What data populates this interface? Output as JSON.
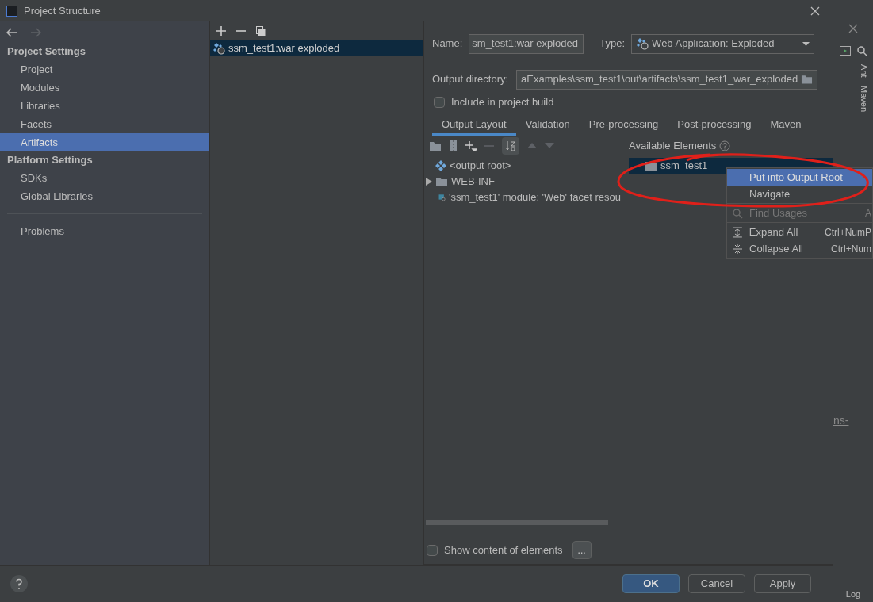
{
  "window": {
    "title": "Project Structure"
  },
  "sidebar": {
    "groups": [
      {
        "title": "Project Settings",
        "items": [
          {
            "label": "Project",
            "selected": false
          },
          {
            "label": "Modules",
            "selected": false
          },
          {
            "label": "Libraries",
            "selected": false
          },
          {
            "label": "Facets",
            "selected": false
          },
          {
            "label": "Artifacts",
            "selected": true
          }
        ]
      },
      {
        "title": "Platform Settings",
        "items": [
          {
            "label": "SDKs",
            "selected": false
          },
          {
            "label": "Global Libraries",
            "selected": false
          }
        ]
      }
    ],
    "extra_items": [
      {
        "label": "Problems",
        "selected": false
      }
    ]
  },
  "artifacts": [
    {
      "label": "ssm_test1:war exploded",
      "selected": true
    }
  ],
  "form": {
    "name_label": "Name:",
    "name_value": "sm_test1:war exploded",
    "type_label": "Type:",
    "type_value": "Web Application: Exploded",
    "output_label": "Output directory:",
    "output_value": "aExamples\\ssm_test1\\out\\artifacts\\ssm_test1_war_exploded",
    "include_label": "Include in project build",
    "include_checked": false
  },
  "tabs": [
    {
      "label": "Output Layout",
      "selected": true
    },
    {
      "label": "Validation",
      "selected": false
    },
    {
      "label": "Pre-processing",
      "selected": false
    },
    {
      "label": "Post-processing",
      "selected": false
    },
    {
      "label": "Maven",
      "selected": false
    }
  ],
  "available_label": "Available Elements",
  "layout_tree": [
    {
      "label": "<output root>",
      "kind": "root"
    },
    {
      "label": "WEB-INF",
      "kind": "folder",
      "expanded": false
    },
    {
      "label": "'ssm_test1' module: 'Web' facet resou",
      "kind": "module"
    }
  ],
  "available_tree": [
    {
      "label": "ssm_test1",
      "selected": true
    }
  ],
  "context_menu": [
    {
      "label": "Put into Output Root",
      "selected": true,
      "disabled": false,
      "kind": "plain"
    },
    {
      "label": "Navigate",
      "selected": false,
      "disabled": false,
      "kind": "plain"
    },
    {
      "label": "Find Usages",
      "shortcut": "A",
      "selected": false,
      "disabled": true,
      "kind": "search"
    },
    {
      "label": "Expand All",
      "shortcut": "Ctrl+NumP",
      "selected": false,
      "disabled": false,
      "kind": "expand"
    },
    {
      "label": "Collapse All",
      "shortcut": "Ctrl+Num",
      "selected": false,
      "disabled": false,
      "kind": "collapse"
    }
  ],
  "show_content": {
    "label": "Show content of elements",
    "checked": false,
    "button": "..."
  },
  "buttons": [
    {
      "label": "OK",
      "default": true
    },
    {
      "label": "Cancel",
      "default": false
    },
    {
      "label": "Apply",
      "default": false
    }
  ],
  "ide_strip": {
    "tool_windows": [
      "Ant",
      "Maven"
    ],
    "editor_text": "ns-",
    "status": "Log"
  }
}
